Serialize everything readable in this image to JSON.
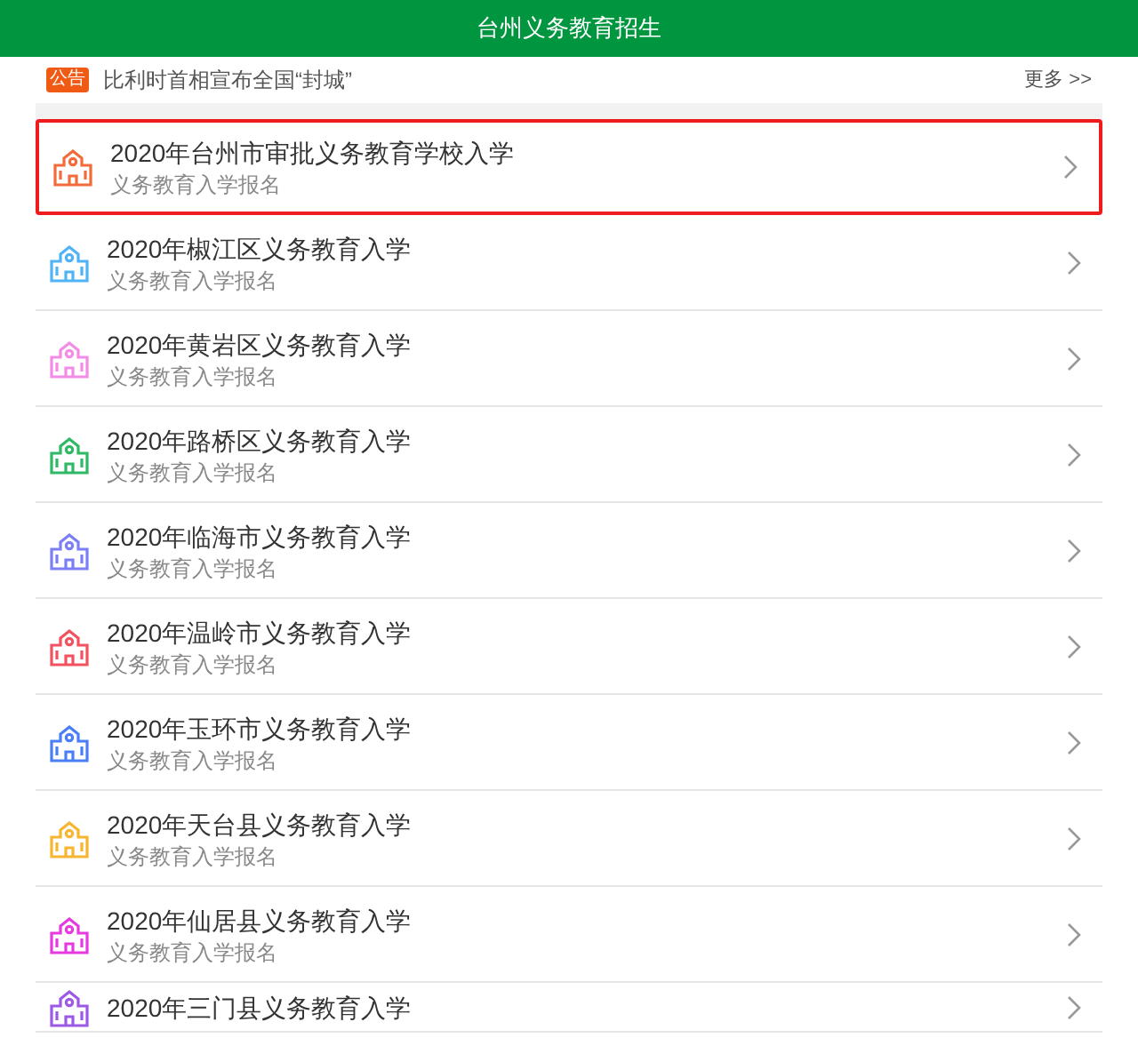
{
  "header": {
    "title": "台州义务教育招生"
  },
  "notice": {
    "badge": "公告",
    "text": "比利时首相宣布全国“封城”",
    "more": "更多 >>"
  },
  "items": [
    {
      "title": "2020年台州市审批义务教育学校入学",
      "subtitle": "义务教育入学报名",
      "color": "#f26b3a",
      "selected": true
    },
    {
      "title": "2020年椒江区义务教育入学",
      "subtitle": "义务教育入学报名",
      "color": "#4fb3f6",
      "selected": false
    },
    {
      "title": "2020年黄岩区义务教育入学",
      "subtitle": "义务教育入学报名",
      "color": "#f28ce6",
      "selected": false
    },
    {
      "title": "2020年路桥区义务教育入学",
      "subtitle": "义务教育入学报名",
      "color": "#2fb865",
      "selected": false
    },
    {
      "title": "2020年临海市义务教育入学",
      "subtitle": "义务教育入学报名",
      "color": "#7b7ef5",
      "selected": false
    },
    {
      "title": "2020年温岭市义务教育入学",
      "subtitle": "义务教育入学报名",
      "color": "#f2525f",
      "selected": false
    },
    {
      "title": "2020年玉环市义务教育入学",
      "subtitle": "义务教育入学报名",
      "color": "#4a7ef5",
      "selected": false
    },
    {
      "title": "2020年天台县义务教育入学",
      "subtitle": "义务教育入学报名",
      "color": "#f8b530",
      "selected": false
    },
    {
      "title": "2020年仙居县义务教育入学",
      "subtitle": "义务教育入学报名",
      "color": "#e53ae0",
      "selected": false
    },
    {
      "title": "2020年三门县义务教育入学",
      "color": "#9b59e6",
      "selected": false
    }
  ]
}
